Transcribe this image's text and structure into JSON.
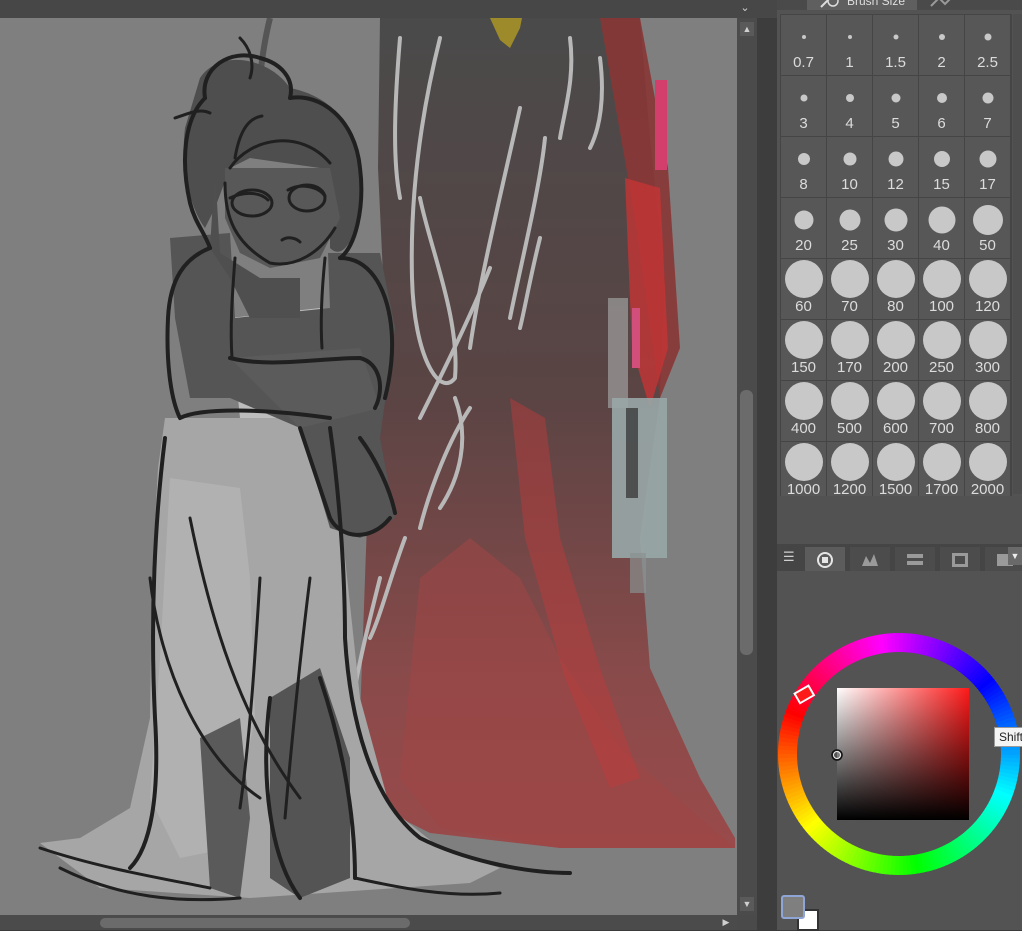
{
  "brush_size_panel": {
    "tab_label": "Brush Size",
    "sizes": [
      "0.7",
      "1",
      "1.5",
      "2",
      "2.5",
      "3",
      "4",
      "5",
      "6",
      "7",
      "8",
      "10",
      "12",
      "15",
      "17",
      "20",
      "25",
      "30",
      "40",
      "50",
      "60",
      "70",
      "80",
      "100",
      "120",
      "150",
      "170",
      "200",
      "250",
      "300",
      "400",
      "500",
      "600",
      "700",
      "800",
      "1000",
      "1200",
      "1500",
      "1700",
      "2000"
    ],
    "selected": null
  },
  "color_panel": {
    "tabs": [
      "color-circle-icon",
      "color-slider-icon",
      "color-set-icon",
      "intermediate-color-icon",
      "approximate-color-icon"
    ],
    "active_tab": "color-circle-icon",
    "tooltip": "Shift",
    "current_color": "#7f7f7f",
    "background_color": "#ffffff",
    "hue_marker_color": "#ff1a1a"
  },
  "canvas": {
    "background_color": "#7f7f7f",
    "scrollbar_vertical_position": 0.45,
    "scrollbar_horizontal_position": 0.14
  }
}
